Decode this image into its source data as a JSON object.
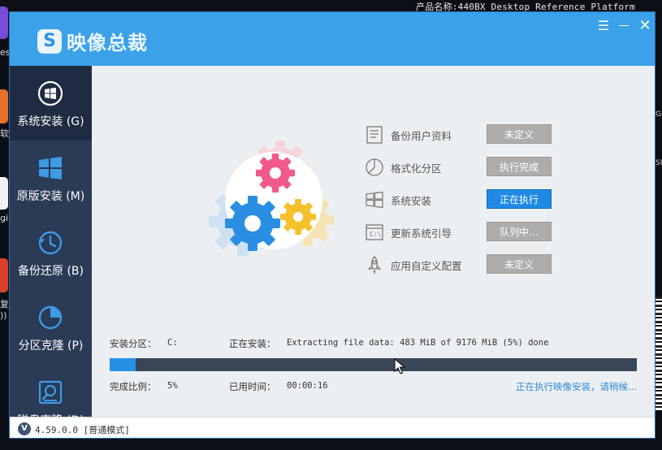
{
  "desktop": {
    "top_text": "产品名称:440BX Desktop Reference Platform",
    "left_labels": [
      "es",
      "软",
      "gi",
      "复",
      "))"
    ],
    "right_labels": [
      "GI",
      "SI"
    ]
  },
  "app": {
    "title": "映像总裁",
    "logo_letter": "S",
    "window_buttons": {
      "menu": "☰",
      "minimize": "—",
      "close": "✕"
    }
  },
  "sidebar": {
    "items": [
      {
        "label": "系统安装 (G)",
        "icon": "windows-logo-icon",
        "active": true
      },
      {
        "label": "原版安装 (M)",
        "icon": "windows-tiles-icon",
        "active": false
      },
      {
        "label": "备份还原 (B)",
        "icon": "clock-restore-icon",
        "active": false
      },
      {
        "label": "分区克隆 (P)",
        "icon": "pie-chart-icon",
        "active": false
      },
      {
        "label": "磁盘克隆 (D)",
        "icon": "disk-icon",
        "active": false
      }
    ]
  },
  "steps": [
    {
      "label": "备份用户资料",
      "status": "未定义",
      "icon": "document-list-icon",
      "running": false
    },
    {
      "label": "格式化分区",
      "status": "执行完成",
      "icon": "pie-format-icon",
      "running": false
    },
    {
      "label": "系统安装",
      "status": "正在执行",
      "icon": "windows-install-icon",
      "running": true
    },
    {
      "label": "更新系统引导",
      "status": "队列中...",
      "icon": "terminal-icon",
      "running": false
    },
    {
      "label": "应用自定义配置",
      "status": "未定义",
      "icon": "rocket-icon",
      "running": false
    }
  ],
  "install": {
    "partition_label": "安装分区：",
    "partition_value": "C:",
    "installing_label": "正在安装：",
    "installing_value": "Extracting file data: 483 MiB of 9176 MiB (5%) done",
    "ratio_label": "完成比例：",
    "ratio_value": "5%",
    "elapsed_label": "已用时间：",
    "elapsed_value": "00:00:16",
    "progress_fraction": 0.05,
    "status_text": "正在执行映像安装，请稍候..."
  },
  "statusbar": {
    "badge": "V",
    "version_text": "4.59.0.0 [普通模式]"
  },
  "colors": {
    "titlebar": "#3ba1e9",
    "sidebar": "#2b3a55",
    "running": "#1e8ae6",
    "idle": "#adadad",
    "progress": "#2590e6"
  }
}
